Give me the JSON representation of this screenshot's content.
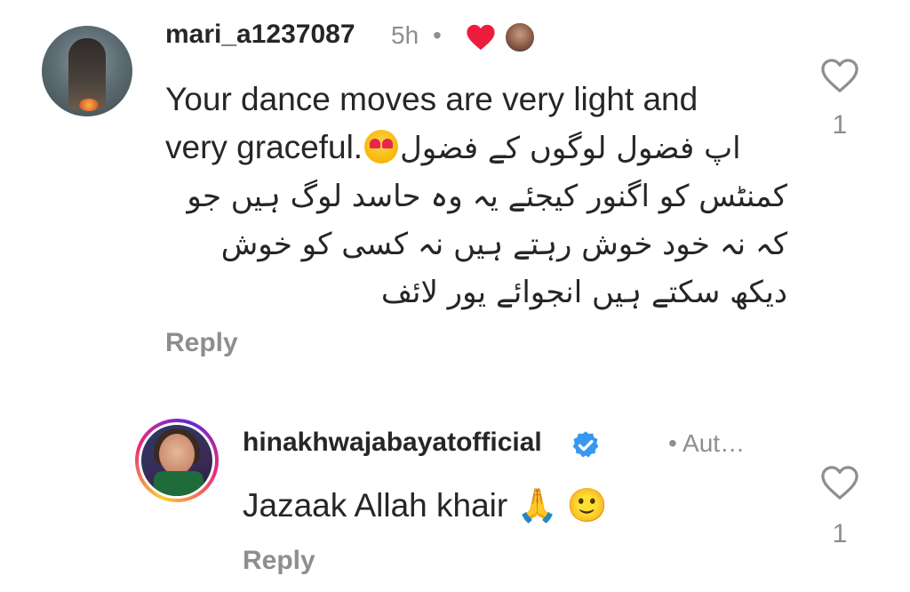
{
  "comment": {
    "username": "mari_a1237087",
    "time": "5h",
    "separator": "•",
    "liked_by_creator": true,
    "text_line1": "Your dance moves are very light and",
    "text_line2_en": "very graceful.",
    "text_line2_ur": "اپ فضول لوگوں کے فضول",
    "text_line3": "کمنٹس کو اگنور کیجئے یہ وہ حاسد لوگ ہیں جو",
    "text_line4": "کہ نہ خود خوش رہتے ہیں نہ کسی کو خوش",
    "text_line5": "دیکھ سکتے ہیں انجوائے یور لائف",
    "reply_label": "Reply",
    "like_count": "1",
    "icons": {
      "avatar": "user-avatar-icon",
      "liked": "heart-filled-icon",
      "creator": "creator-avatar-icon",
      "emoji": "heart-eyes-emoji-icon",
      "like": "heart-outline-icon"
    },
    "colors": {
      "liked_heart": "#ed1c3c"
    }
  },
  "reply": {
    "username": "hinakhwajabayatofficial",
    "verified": true,
    "meta": "• Aut…",
    "text": "Jazaak Allah khair",
    "emojis": "🙏 🙂",
    "reply_label": "Reply",
    "like_count": "1",
    "icons": {
      "avatar": "user-avatar-story-ring-icon",
      "verified": "verified-badge-icon",
      "like": "heart-outline-icon"
    },
    "colors": {
      "verified": "#3897f0"
    }
  }
}
